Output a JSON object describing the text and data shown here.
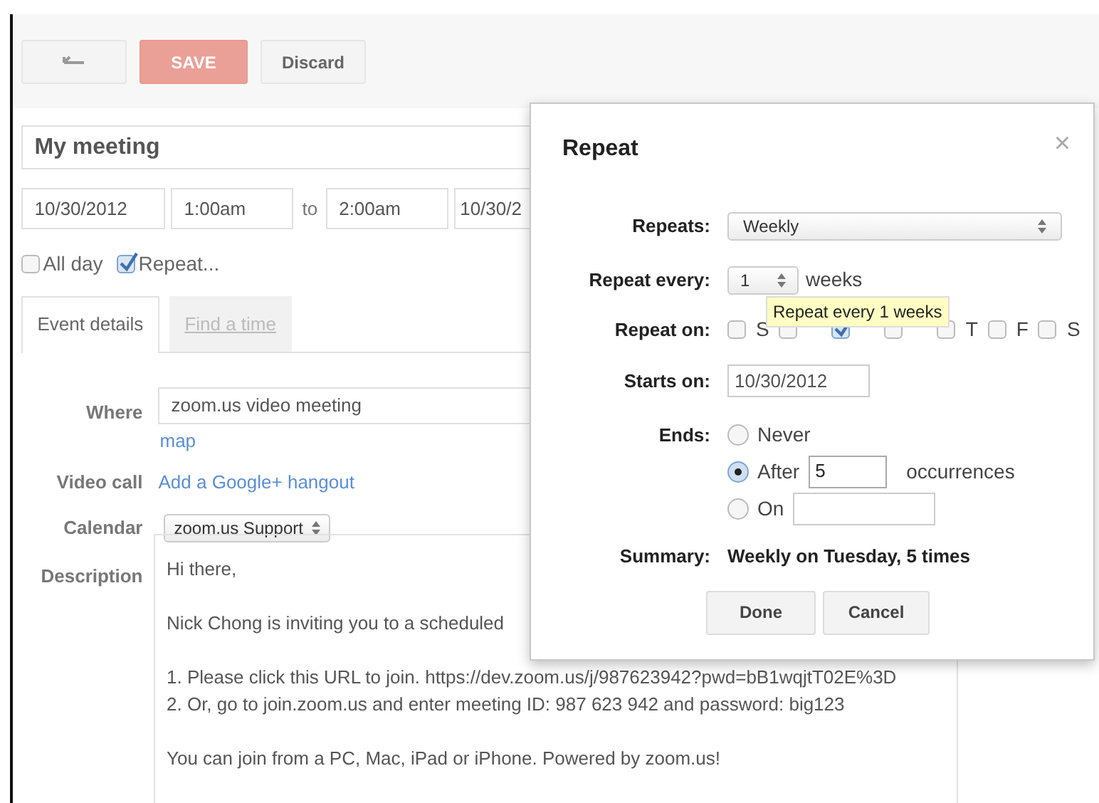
{
  "toolbar": {
    "buttons": [
      {
        "kind": "back"
      },
      {
        "kind": "primary",
        "label": "SAVE"
      },
      {
        "kind": "default",
        "label": "Discard"
      }
    ]
  },
  "event": {
    "title": "My meeting",
    "start_date": "10/30/2012",
    "start_time": "1:00am",
    "to_label": "to",
    "end_time": "2:00am",
    "end_date": "10/30/2",
    "options": [
      {
        "label": "All day",
        "checked": false
      },
      {
        "label": "Repeat...",
        "checked": true
      }
    ]
  },
  "tabs": [
    {
      "label": "Event details",
      "selected": true
    },
    {
      "label": "Find a time",
      "selected": false
    }
  ],
  "details": {
    "where": {
      "label": "Where",
      "value": "zoom.us video meeting",
      "link": "map"
    },
    "video_call": {
      "label": "Video call",
      "link": "Add a Google+ hangout"
    },
    "calendar": {
      "label": "Calendar",
      "value": "zoom.us Support"
    },
    "description": {
      "label": "Description",
      "paragraphs": [
        {
          "lines": [
            "Hi there,"
          ]
        },
        {
          "lines": [
            "Nick Chong is inviting you to a scheduled"
          ]
        },
        {
          "lines": [
            "1. Please click this URL to join. https://dev.zoom.us/j/987623942?pwd=bB1wqjtT02E%3D",
            "2. Or, go to join.zoom.us and enter meeting ID: 987 623 942 and password: big123"
          ]
        },
        {
          "lines": [
            "You can join from a PC, Mac, iPad or iPhone. Powered by zoom.us!"
          ]
        }
      ]
    }
  },
  "dialog": {
    "title": "Repeat",
    "close": "×",
    "repeats": {
      "label": "Repeats:",
      "value": "Weekly"
    },
    "every": {
      "label": "Repeat every:",
      "value": "1",
      "unit": "weeks"
    },
    "repeat_on": {
      "label": "Repeat on:",
      "days": [
        {
          "label": "S",
          "checked": false
        },
        {
          "checked": false
        },
        {
          "checked": true
        },
        {
          "checked": false
        },
        {
          "label": "T",
          "checked": false
        },
        {
          "label": "F",
          "checked": false
        },
        {
          "label": "S",
          "checked": false
        }
      ]
    },
    "tooltip": "Repeat every 1 weeks",
    "starts_on": {
      "label": "Starts on:",
      "value": "10/30/2012"
    },
    "ends": {
      "label": "Ends:",
      "options": [
        {
          "kind": "never",
          "label": "Never",
          "selected": false
        },
        {
          "kind": "after",
          "label": "After",
          "value": "5",
          "suffix": "occurrences",
          "selected": true
        },
        {
          "kind": "on",
          "label": "On",
          "selected": false
        }
      ]
    },
    "summary": {
      "label": "Summary:",
      "value": "Weekly on Tuesday, 5 times"
    },
    "buttons": [
      "Done",
      "Cancel"
    ]
  }
}
